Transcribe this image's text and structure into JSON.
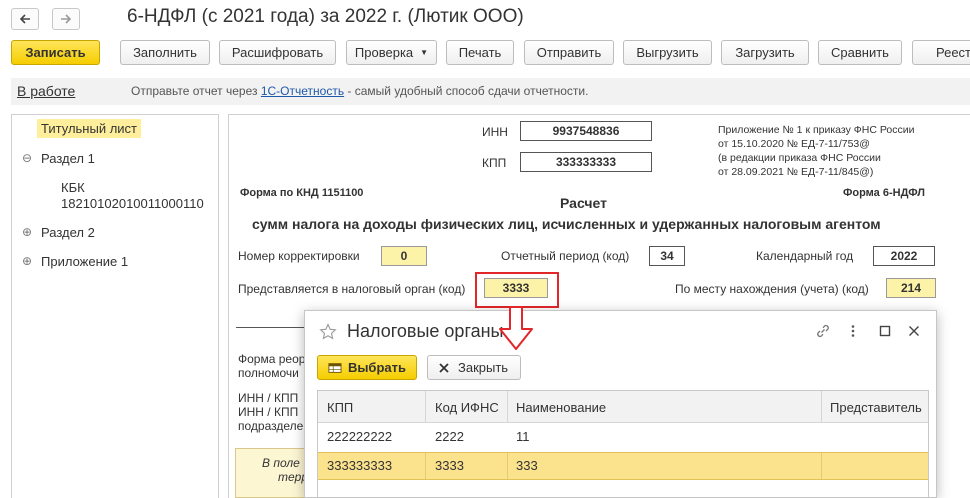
{
  "window": {
    "title": "6-НДФЛ (с 2021 года) за 2022 г. (Лютик ООО)"
  },
  "toolbar": {
    "save": "Записать",
    "fill": "Заполнить",
    "decode": "Расшифровать",
    "check": "Проверка",
    "print": "Печать",
    "send": "Отправить",
    "export": "Выгрузить",
    "import": "Загрузить",
    "compare": "Сравнить",
    "registry": "Реест"
  },
  "status": {
    "state_link": "В работе",
    "hint_prefix": "Отправьте отчет через ",
    "hint_link": "1С-Отчетность",
    "hint_suffix": " - самый удобный способ сдачи отчетности."
  },
  "tree": {
    "title_page": "Титульный лист",
    "section1": "Раздел 1",
    "kbk_label": "КБК",
    "kbk_value": "18210102010011000110",
    "section2": "Раздел 2",
    "appendix1": "Приложение 1",
    "toggle_minus": "⊖",
    "toggle_plus": "⊕"
  },
  "form": {
    "inn_label": "ИНН",
    "inn_value": "9937548836",
    "kpp_label": "КПП",
    "kpp_value": "333333333",
    "note1": "Приложение № 1 к приказу ФНС России",
    "note2": "от 15.10.2020 № ЕД-7-11/753@",
    "note3": "(в редакции приказа ФНС России",
    "note4": "от 28.09.2021 № ЕД-7-11/845@)",
    "knd": "Форма по КНД 1151100",
    "form_name": "Форма 6-НДФЛ",
    "heading1": "Расчет",
    "heading2": "сумм налога на доходы физических лиц, исчисленных и удержанных налоговым агентом",
    "correction_label": "Номер корректировки",
    "correction_value": "0",
    "period_label": "Отчетный период (код)",
    "period_value": "34",
    "year_label": "Календарный год",
    "year_value": "2022",
    "tax_office_label": "Представляется в налоговый орган (код)",
    "tax_office_value": "3333",
    "location_label": "По месту нахождения (учета) (код)",
    "location_value": "214",
    "reorg_line1": "Форма реор",
    "reorg_line2": "полномочи",
    "innkpp_line1": "ИНН / КПП",
    "innkpp_line2": "ИНН / КПП",
    "innkpp_line3": "подразделе",
    "field_note1": "В поле",
    "field_note2": "терри"
  },
  "modal": {
    "title": "Налоговые органы",
    "select": "Выбрать",
    "close": "Закрыть",
    "columns": [
      "КПП",
      "Код ИФНС",
      "Наименование",
      "Представитель"
    ],
    "rows": [
      [
        "222222222",
        "2222",
        "11"
      ],
      [
        "333333333",
        "3333",
        "333"
      ]
    ]
  }
}
